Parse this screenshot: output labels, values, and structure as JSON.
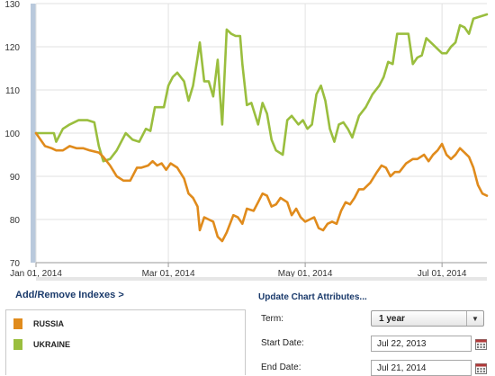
{
  "chart_data": {
    "type": "line",
    "title": "",
    "xlabel": "",
    "ylabel": "",
    "ylim": [
      70,
      130
    ],
    "yticks": [
      70,
      80,
      90,
      100,
      110,
      120,
      130
    ],
    "xticks": [
      {
        "label": "Jan 01, 2014",
        "date": "2014-01-01"
      },
      {
        "label": "Mar 01, 2014",
        "date": "2014-03-01"
      },
      {
        "label": "May 01, 2014",
        "date": "2014-05-01"
      },
      {
        "label": "Jul 01, 2014",
        "date": "2014-07-01"
      }
    ],
    "xrange": [
      "2014-01-01",
      "2014-07-21"
    ],
    "grid": true,
    "series": [
      {
        "name": "UKRAINE",
        "color": "#9abe3e",
        "points": [
          [
            "2014-01-01",
            100
          ],
          [
            "2014-01-03",
            100
          ],
          [
            "2014-01-06",
            100
          ],
          [
            "2014-01-09",
            100
          ],
          [
            "2014-01-10",
            98
          ],
          [
            "2014-01-13",
            101
          ],
          [
            "2014-01-16",
            102
          ],
          [
            "2014-01-20",
            103
          ],
          [
            "2014-01-24",
            103
          ],
          [
            "2014-01-27",
            102.5
          ],
          [
            "2014-01-29",
            97
          ],
          [
            "2014-01-31",
            93.5
          ],
          [
            "2014-02-03",
            94
          ],
          [
            "2014-02-06",
            96
          ],
          [
            "2014-02-10",
            100
          ],
          [
            "2014-02-13",
            98.5
          ],
          [
            "2014-02-16",
            98
          ],
          [
            "2014-02-19",
            101
          ],
          [
            "2014-02-21",
            100.5
          ],
          [
            "2014-02-23",
            106
          ],
          [
            "2014-02-25",
            106
          ],
          [
            "2014-02-27",
            106
          ],
          [
            "2014-03-01",
            111
          ],
          [
            "2014-03-03",
            113
          ],
          [
            "2014-03-05",
            114
          ],
          [
            "2014-03-08",
            112
          ],
          [
            "2014-03-10",
            107.5
          ],
          [
            "2014-03-12",
            111
          ],
          [
            "2014-03-14",
            117.5
          ],
          [
            "2014-03-15",
            121
          ],
          [
            "2014-03-17",
            112
          ],
          [
            "2014-03-19",
            112
          ],
          [
            "2014-03-21",
            108.5
          ],
          [
            "2014-03-23",
            117
          ],
          [
            "2014-03-24",
            109
          ],
          [
            "2014-03-25",
            102
          ],
          [
            "2014-03-27",
            124
          ],
          [
            "2014-03-29",
            123
          ],
          [
            "2014-03-31",
            122.5
          ],
          [
            "2014-04-02",
            122.5
          ],
          [
            "2014-04-03",
            116
          ],
          [
            "2014-04-05",
            106.5
          ],
          [
            "2014-04-07",
            107
          ],
          [
            "2014-04-10",
            102
          ],
          [
            "2014-04-12",
            107
          ],
          [
            "2014-04-14",
            104.5
          ],
          [
            "2014-04-16",
            98.5
          ],
          [
            "2014-04-18",
            96
          ],
          [
            "2014-04-21",
            95
          ],
          [
            "2014-04-23",
            103
          ],
          [
            "2014-04-25",
            104
          ],
          [
            "2014-04-28",
            102
          ],
          [
            "2014-04-30",
            103
          ],
          [
            "2014-05-02",
            101
          ],
          [
            "2014-05-04",
            102
          ],
          [
            "2014-05-06",
            109
          ],
          [
            "2014-05-08",
            111
          ],
          [
            "2014-05-10",
            107.5
          ],
          [
            "2014-05-12",
            101
          ],
          [
            "2014-05-14",
            98
          ],
          [
            "2014-05-16",
            102
          ],
          [
            "2014-05-18",
            102.5
          ],
          [
            "2014-05-20",
            101
          ],
          [
            "2014-05-22",
            99
          ],
          [
            "2014-05-25",
            104
          ],
          [
            "2014-05-28",
            106
          ],
          [
            "2014-05-31",
            109
          ],
          [
            "2014-06-03",
            111
          ],
          [
            "2014-06-05",
            113
          ],
          [
            "2014-06-07",
            116.5
          ],
          [
            "2014-06-09",
            116
          ],
          [
            "2014-06-11",
            123
          ],
          [
            "2014-06-14",
            123
          ],
          [
            "2014-06-16",
            123
          ],
          [
            "2014-06-18",
            116
          ],
          [
            "2014-06-20",
            117.5
          ],
          [
            "2014-06-22",
            118
          ],
          [
            "2014-06-24",
            122
          ],
          [
            "2014-06-27",
            120.5
          ],
          [
            "2014-07-01",
            118.5
          ],
          [
            "2014-07-03",
            118.5
          ],
          [
            "2014-07-05",
            120
          ],
          [
            "2014-07-07",
            121
          ],
          [
            "2014-07-09",
            125
          ],
          [
            "2014-07-11",
            124.5
          ],
          [
            "2014-07-13",
            123
          ],
          [
            "2014-07-15",
            126.5
          ],
          [
            "2014-07-18",
            127
          ],
          [
            "2014-07-21",
            127.5
          ]
        ]
      },
      {
        "name": "RUSSIA",
        "color": "#e08b1c",
        "points": [
          [
            "2014-01-01",
            100
          ],
          [
            "2014-01-03",
            98.5
          ],
          [
            "2014-01-05",
            97
          ],
          [
            "2014-01-08",
            96.5
          ],
          [
            "2014-01-10",
            96
          ],
          [
            "2014-01-13",
            96
          ],
          [
            "2014-01-16",
            97
          ],
          [
            "2014-01-19",
            96.5
          ],
          [
            "2014-01-22",
            96.5
          ],
          [
            "2014-01-25",
            96
          ],
          [
            "2014-01-29",
            95.5
          ],
          [
            "2014-01-31",
            94.5
          ],
          [
            "2014-02-03",
            92.5
          ],
          [
            "2014-02-06",
            90
          ],
          [
            "2014-02-09",
            89
          ],
          [
            "2014-02-12",
            89
          ],
          [
            "2014-02-15",
            92
          ],
          [
            "2014-02-17",
            92
          ],
          [
            "2014-02-20",
            92.5
          ],
          [
            "2014-02-22",
            93.5
          ],
          [
            "2014-02-24",
            92.5
          ],
          [
            "2014-02-26",
            93
          ],
          [
            "2014-02-28",
            91.5
          ],
          [
            "2014-03-02",
            93
          ],
          [
            "2014-03-05",
            92
          ],
          [
            "2014-03-08",
            89.5
          ],
          [
            "2014-03-10",
            86
          ],
          [
            "2014-03-12",
            85
          ],
          [
            "2014-03-14",
            83
          ],
          [
            "2014-03-15",
            77.5
          ],
          [
            "2014-03-17",
            80.5
          ],
          [
            "2014-03-19",
            80
          ],
          [
            "2014-03-21",
            79.5
          ],
          [
            "2014-03-23",
            76
          ],
          [
            "2014-03-25",
            75
          ],
          [
            "2014-03-27",
            77
          ],
          [
            "2014-03-30",
            81
          ],
          [
            "2014-04-01",
            80.5
          ],
          [
            "2014-04-03",
            79
          ],
          [
            "2014-04-05",
            82.5
          ],
          [
            "2014-04-08",
            82
          ],
          [
            "2014-04-10",
            84
          ],
          [
            "2014-04-12",
            86
          ],
          [
            "2014-04-14",
            85.5
          ],
          [
            "2014-04-16",
            83
          ],
          [
            "2014-04-18",
            83.5
          ],
          [
            "2014-04-20",
            85
          ],
          [
            "2014-04-23",
            84
          ],
          [
            "2014-04-25",
            81
          ],
          [
            "2014-04-27",
            82.5
          ],
          [
            "2014-04-29",
            80.5
          ],
          [
            "2014-05-01",
            79.5
          ],
          [
            "2014-05-03",
            80
          ],
          [
            "2014-05-05",
            80.5
          ],
          [
            "2014-05-07",
            78
          ],
          [
            "2014-05-09",
            77.5
          ],
          [
            "2014-05-11",
            79
          ],
          [
            "2014-05-13",
            79.5
          ],
          [
            "2014-05-15",
            79
          ],
          [
            "2014-05-17",
            82
          ],
          [
            "2014-05-19",
            84
          ],
          [
            "2014-05-21",
            83.5
          ],
          [
            "2014-05-23",
            85
          ],
          [
            "2014-05-25",
            87
          ],
          [
            "2014-05-27",
            87
          ],
          [
            "2014-05-30",
            88.5
          ],
          [
            "2014-06-02",
            91
          ],
          [
            "2014-06-04",
            92.5
          ],
          [
            "2014-06-06",
            92
          ],
          [
            "2014-06-08",
            90
          ],
          [
            "2014-06-10",
            91
          ],
          [
            "2014-06-12",
            91
          ],
          [
            "2014-06-15",
            93
          ],
          [
            "2014-06-18",
            94
          ],
          [
            "2014-06-20",
            94
          ],
          [
            "2014-06-23",
            95
          ],
          [
            "2014-06-25",
            93.5
          ],
          [
            "2014-06-27",
            95
          ],
          [
            "2014-06-29",
            96
          ],
          [
            "2014-07-01",
            97.5
          ],
          [
            "2014-07-03",
            95
          ],
          [
            "2014-07-05",
            94
          ],
          [
            "2014-07-07",
            95
          ],
          [
            "2014-07-09",
            96.5
          ],
          [
            "2014-07-11",
            95.5
          ],
          [
            "2014-07-13",
            94.5
          ],
          [
            "2014-07-15",
            92
          ],
          [
            "2014-07-17",
            88
          ],
          [
            "2014-07-19",
            86
          ],
          [
            "2014-07-21",
            85.5
          ]
        ]
      }
    ]
  },
  "links": {
    "add_remove": "Add/Remove Indexes >"
  },
  "legend": {
    "items": [
      {
        "name": "RUSSIA",
        "color": "#e08b1c"
      },
      {
        "name": "UKRAINE",
        "color": "#9abe3e"
      }
    ]
  },
  "attributes": {
    "title": "Update Chart Attributes...",
    "term_label": "Term:",
    "term_value": "1 year",
    "start_label": "Start Date:",
    "start_value": "Jul 22, 2013",
    "end_label": "End Date:",
    "end_value": "Jul 21, 2014"
  }
}
